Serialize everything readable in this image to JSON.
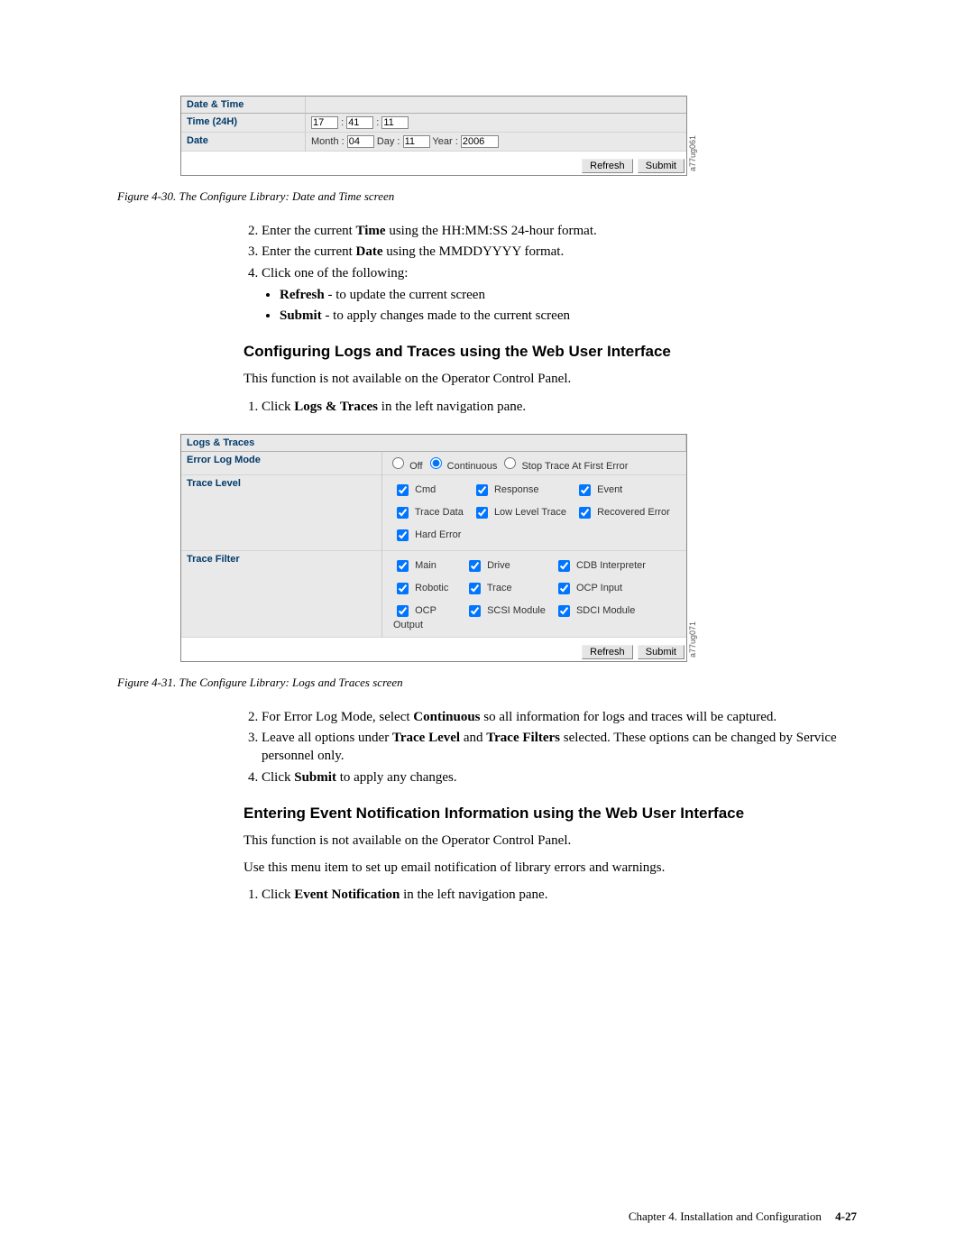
{
  "fig30": {
    "caption": "Figure 4-30. The Configure Library: Date and Time screen",
    "side_code": "a77ug061",
    "panel_title": "Date & Time",
    "row_time_label": "Time (24H)",
    "row_time_hh": "17",
    "row_time_mm": "41",
    "row_time_ss": "11",
    "row_time_colon": ":",
    "row_date_label": "Date",
    "row_date_month_label": "Month :",
    "row_date_month": "04",
    "row_date_day_label": "Day :",
    "row_date_day": "11",
    "row_date_year_label": "Year :",
    "row_date_year": "2006",
    "btn_refresh": "Refresh",
    "btn_submit": "Submit"
  },
  "instr_a": {
    "i2_a": "Enter the current ",
    "i2_b": "Time",
    "i2_c": " using the HH:MM:SS 24-hour format.",
    "i3_a": "Enter the current ",
    "i3_b": "Date",
    "i3_c": " using the MMDDYYYY format.",
    "i4": "Click one of the following:",
    "b1_a": "Refresh",
    "b1_b": " - to update the current screen",
    "b2_a": "Submit",
    "b2_b": " - to apply changes made to the current screen"
  },
  "heading1": "Configuring Logs and Traces using the Web User Interface",
  "para1": "This function is not available on the Operator Control Panel.",
  "instr_b": {
    "i1_a": "Click ",
    "i1_b": "Logs & Traces",
    "i1_c": " in the left navigation pane."
  },
  "fig31": {
    "caption": "Figure 4-31. The Configure Library: Logs and Traces screen",
    "side_code": "a77ug071",
    "panel_title": "Logs & Traces",
    "row_mode_label": "Error Log Mode",
    "row_mode_opt_off": "Off",
    "row_mode_opt_cont": "Continuous",
    "row_mode_opt_stop": "Stop Trace At First Error",
    "row_level_label": "Trace Level",
    "lvl": {
      "cmd": "Cmd",
      "response": "Response",
      "event": "Event",
      "tracedata": "Trace Data",
      "lowlevel": "Low Level Trace",
      "recovered": "Recovered Error",
      "harderror": "Hard Error"
    },
    "row_filter_label": "Trace Filter",
    "flt": {
      "main": "Main",
      "drive": "Drive",
      "cdb": "CDB Interpreter",
      "robotic": "Robotic",
      "trace": "Trace",
      "ocpin": "OCP Input",
      "ocpout": "OCP Output",
      "scsim": "SCSI Module",
      "sdcim": "SDCI Module"
    },
    "btn_refresh": "Refresh",
    "btn_submit": "Submit"
  },
  "instr_c": {
    "i2_a": "For Error Log Mode, select ",
    "i2_b": "Continuous",
    "i2_c": " so all information for logs and traces will be captured.",
    "i3_a": "Leave all options under ",
    "i3_b": "Trace Level",
    "i3_mid": " and ",
    "i3_c": "Trace Filters",
    "i3_d": " selected. These options can be changed by Service personnel only.",
    "i4_a": "Click ",
    "i4_b": "Submit",
    "i4_c": " to apply any changes."
  },
  "heading2": "Entering Event Notification Information using the Web User Interface",
  "para2": "This function is not available on the Operator Control Panel.",
  "para3": "Use this menu item to set up email notification of library errors and warnings.",
  "instr_d": {
    "i1_a": "Click ",
    "i1_b": "Event Notification",
    "i1_c": " in the left navigation pane."
  },
  "footer_text": "Chapter 4. Installation and Configuration",
  "footer_page": "4-27"
}
